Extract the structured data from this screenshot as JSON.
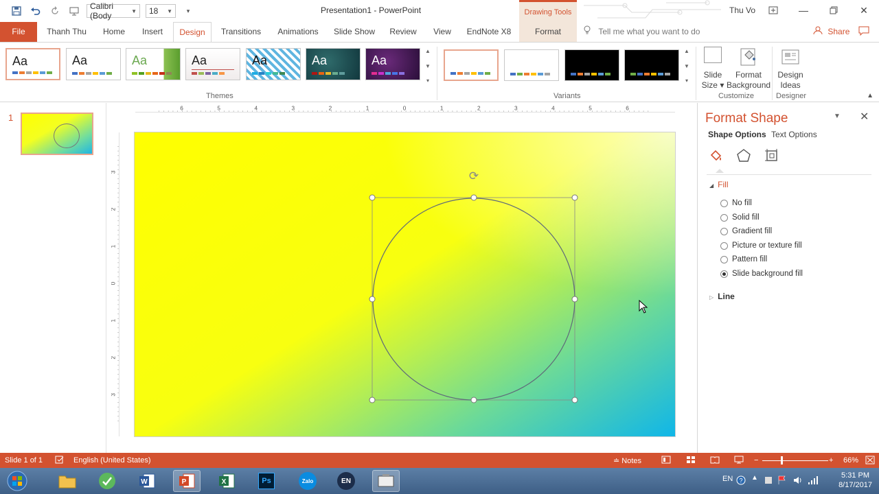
{
  "window": {
    "title": "Presentation1  -  PowerPoint",
    "contextual_tab_group": "Drawing Tools",
    "user": "Thu Vo",
    "font_name": "Calibri (Body",
    "font_size": "18"
  },
  "tabs": [
    "File",
    "Thanh Thu",
    "Home",
    "Insert",
    "Design",
    "Transitions",
    "Animations",
    "Slide Show",
    "Review",
    "View",
    "EndNote X8",
    "Format"
  ],
  "active_tab": "Design",
  "tell_me": "Tell me what you want to do",
  "share": "Share",
  "ribbon": {
    "themes_label": "Themes",
    "variants_label": "Variants",
    "customize_label": "Customize",
    "designer_label": "Designer",
    "theme_sample": "Aa",
    "slide_size": [
      "Slide",
      "Size"
    ],
    "format_background": [
      "Format",
      "Background"
    ],
    "design_ideas": [
      "Design",
      "Ideas"
    ]
  },
  "ruler": {
    "h_ticks": [
      "6",
      "5",
      "4",
      "3",
      "2",
      "1",
      "0",
      "1",
      "2",
      "3",
      "4",
      "5",
      "6"
    ],
    "v_ticks": [
      "3",
      "2",
      "1",
      "0",
      "1",
      "2",
      "3"
    ]
  },
  "thumbnails": {
    "slide_number": "1"
  },
  "format_pane": {
    "title": "Format Shape",
    "tab_shape": "Shape Options",
    "tab_text": "Text Options",
    "fill_section": "Fill",
    "line_section": "Line",
    "fill_options": [
      {
        "label": "No fill",
        "selected": false
      },
      {
        "label": "Solid fill",
        "selected": false
      },
      {
        "label": "Gradient fill",
        "selected": false
      },
      {
        "label": "Picture or texture fill",
        "selected": false
      },
      {
        "label": "Pattern fill",
        "selected": false
      },
      {
        "label": "Slide background fill",
        "selected": true
      }
    ]
  },
  "statusbar": {
    "slide_info": "Slide 1 of 1",
    "language": "English (United States)",
    "notes": "Notes",
    "zoom": "66%"
  },
  "taskbar": {
    "lang": "EN",
    "time": "5:31 PM",
    "date": "8/17/2017",
    "app_zalo": "Zalo",
    "app_en": "EN",
    "app_ps": "Ps"
  },
  "colors": {
    "accent": "#d35230",
    "slide_yellow": "#ffff00",
    "slide_blue": "#10b6e8"
  }
}
